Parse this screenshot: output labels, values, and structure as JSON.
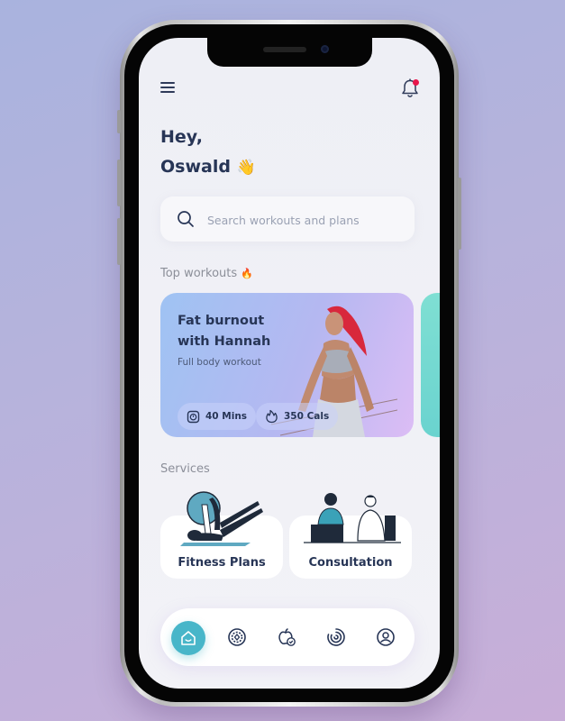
{
  "header": {
    "menu_icon": "hamburger-menu-icon",
    "notification_icon": "bell-icon",
    "notification_badge_color": "#e8174c"
  },
  "greeting": {
    "line1": "Hey,",
    "line2": "Oswald",
    "emoji": "👋"
  },
  "search": {
    "icon": "search-icon",
    "placeholder": "Search workouts and plans",
    "value": ""
  },
  "top_workouts": {
    "title": "Top workouts",
    "emoji": "🔥",
    "cards": [
      {
        "title": "Fat burnout with Hannah",
        "title_line1": "Fat burnout",
        "title_line2": "with Hannah",
        "subtitle": "Full body workout",
        "duration": "40 Mins",
        "duration_icon": "stopwatch-icon",
        "calories": "350 Cals",
        "calories_icon": "flame-icon"
      }
    ]
  },
  "services": {
    "title": "Services",
    "items": [
      {
        "label": "Fitness Plans",
        "illustration": "pilates-ball-illustration"
      },
      {
        "label": "Consultation",
        "illustration": "doctor-consultation-illustration"
      }
    ]
  },
  "bottom_nav": {
    "items": [
      {
        "name": "home",
        "icon": "home-icon",
        "active": true
      },
      {
        "name": "workouts",
        "icon": "target-dial-icon",
        "active": false
      },
      {
        "name": "nutrition",
        "icon": "apple-check-icon",
        "active": false
      },
      {
        "name": "progress",
        "icon": "activity-rings-icon",
        "active": false
      },
      {
        "name": "profile",
        "icon": "user-profile-icon",
        "active": false
      }
    ],
    "active_color": "#48b6c9"
  },
  "colors": {
    "primary_text": "#273556",
    "muted_text": "#8c8f99",
    "accent": "#48b6c9"
  }
}
